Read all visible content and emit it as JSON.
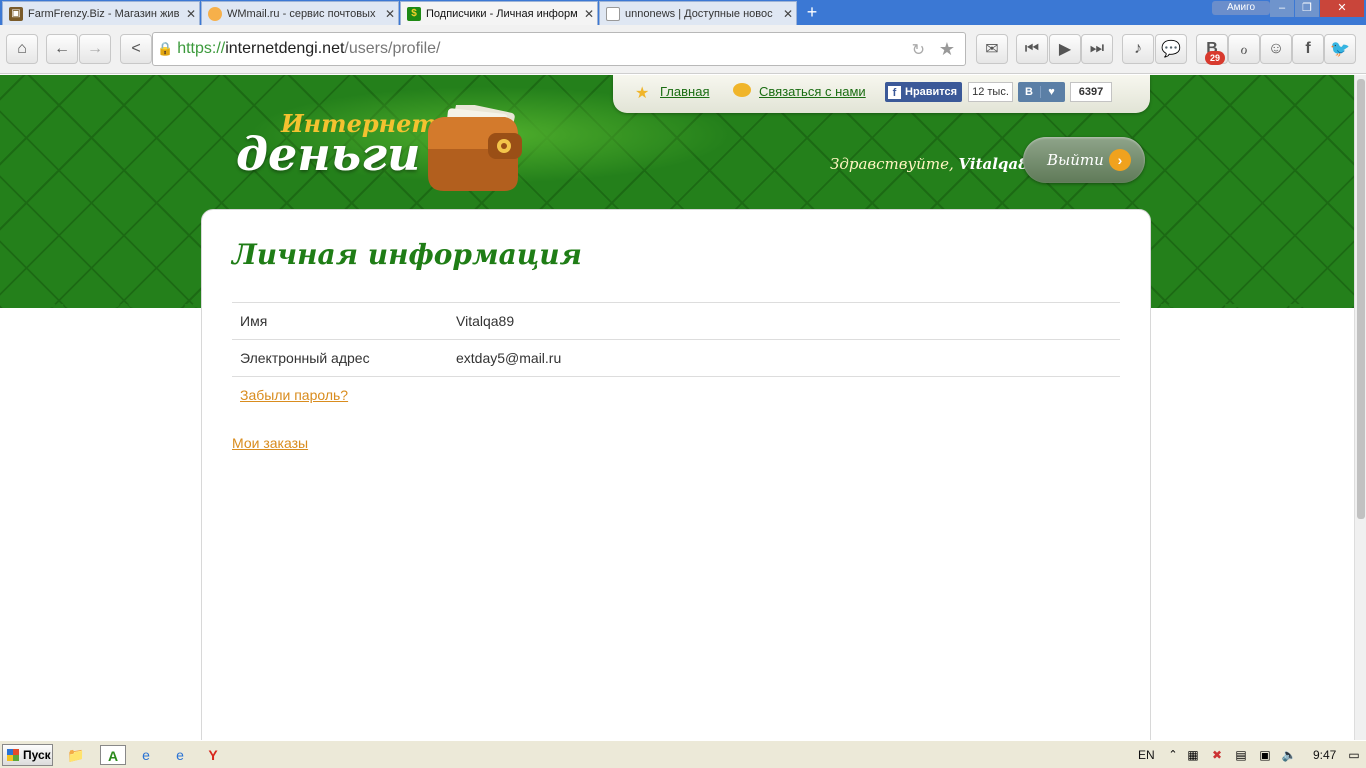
{
  "browser": {
    "tabs": [
      {
        "title": "FarmFrenzy.Biz - Магазин жив",
        "active": false
      },
      {
        "title": "WMmail.ru - сервис почтовых",
        "active": false
      },
      {
        "title": "Подписчики - Личная информ",
        "active": true
      },
      {
        "title": "unnonews | Доступные новос",
        "active": false
      }
    ],
    "new_tab": "+",
    "profile_button": "Амиго",
    "url": {
      "scheme": "https://",
      "host": "internetdengi.net",
      "path": "/users/profile/"
    },
    "notification_count": "29"
  },
  "site": {
    "logo_line1": "Интернет",
    "logo_line2": "деньги",
    "nav": {
      "home": "Главная",
      "contact": "Связаться с нами"
    },
    "social": {
      "fb_like": "Нравится",
      "fb_count": "12 тыс.",
      "vk_label": "В",
      "vk_count": "6397"
    },
    "greeting": "Здравствуйте,",
    "username": "Vitalqa89",
    "logout": "Выйти"
  },
  "profile": {
    "title": "Личная информация",
    "rows": [
      {
        "label": "Имя",
        "value": "Vitalqa89"
      },
      {
        "label": "Электронный адрес",
        "value": "extday5@mail.ru"
      }
    ],
    "forgot_password": "Забыли пароль?",
    "my_orders": "Мои заказы"
  },
  "taskbar": {
    "start": "Пуск",
    "lang": "EN",
    "time": "9:47"
  },
  "colors": {
    "brand_green": "#24801b",
    "title_green": "#1f7d16",
    "link_orange": "#d98c1e"
  }
}
